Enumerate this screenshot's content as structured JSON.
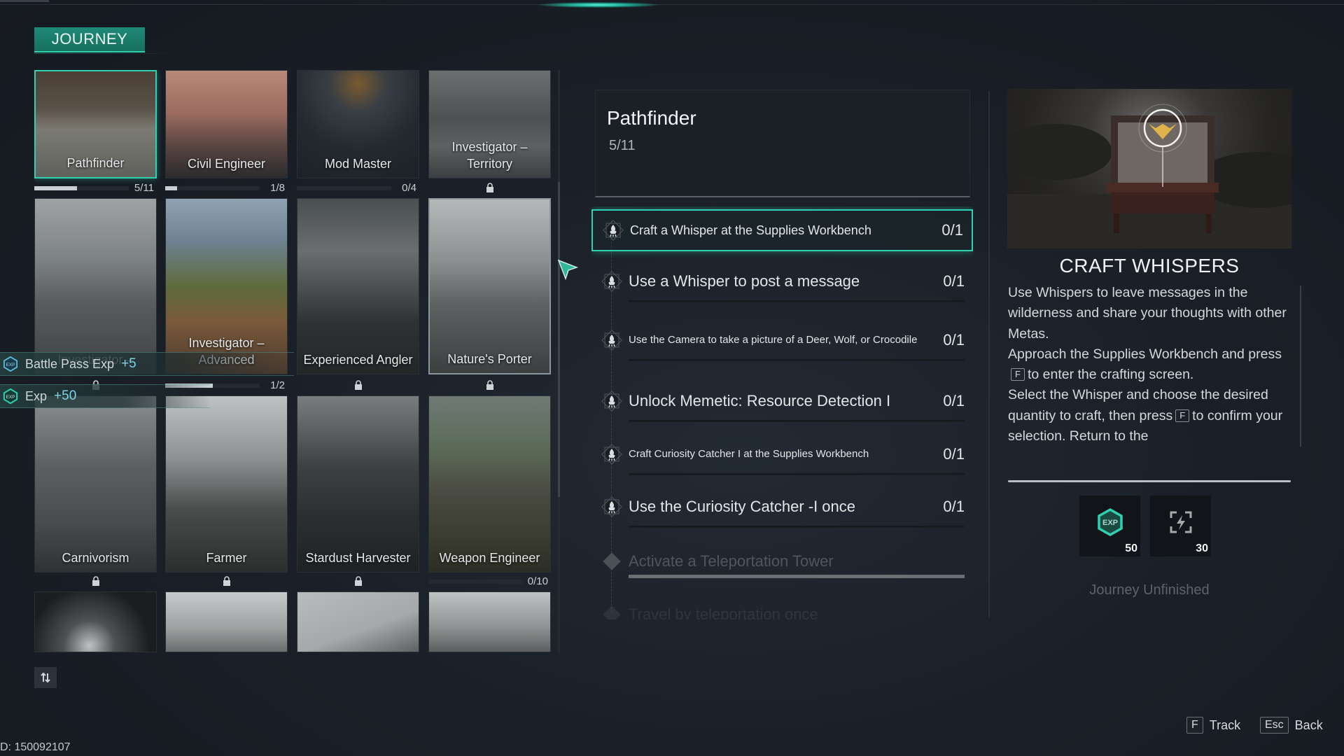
{
  "header": {
    "tab_label": "JOURNEY"
  },
  "cards": [
    {
      "name": "Pathfinder",
      "progress": "5/11",
      "fraction": 0.45,
      "locked": false,
      "selected": true
    },
    {
      "name": "Civil Engineer",
      "progress": "1/8",
      "fraction": 0.125,
      "locked": false
    },
    {
      "name": "Mod Master",
      "progress": "0/4",
      "fraction": 0,
      "locked": false
    },
    {
      "name": "Investigator – Territory",
      "progress": "",
      "locked": true
    },
    {
      "name": "Investigator –",
      "progress": "",
      "locked": true
    },
    {
      "name": "Investigator – Advanced",
      "progress": "1/2",
      "fraction": 0.5,
      "locked": false
    },
    {
      "name": "Experienced Angler",
      "progress": "",
      "locked": true
    },
    {
      "name": "Nature's Porter",
      "progress": "",
      "locked": true,
      "hover": true
    },
    {
      "name": "Carnivorism",
      "progress": "",
      "locked": true
    },
    {
      "name": "Farmer",
      "progress": "",
      "locked": true
    },
    {
      "name": "Stardust Harvester",
      "progress": "",
      "locked": true
    },
    {
      "name": "Weapon Engineer",
      "progress": "0/10",
      "fraction": 0,
      "locked": false
    },
    {
      "name": "",
      "progress": ""
    },
    {
      "name": "",
      "progress": ""
    },
    {
      "name": "",
      "progress": ""
    },
    {
      "name": "",
      "progress": ""
    }
  ],
  "toasts": [
    {
      "label": "Battle Pass Exp",
      "value": "+5",
      "icon": "battle-pass-exp-icon"
    },
    {
      "label": "Exp",
      "value": "+50",
      "icon": "exp-icon"
    }
  ],
  "quest": {
    "title": "Pathfinder",
    "progress": "5/11",
    "tasks": [
      {
        "text": "Craft a Whisper at the Supplies Workbench",
        "count": "0/1",
        "state": "selected"
      },
      {
        "text": "Use a Whisper to post a message",
        "count": "0/1",
        "state": "active"
      },
      {
        "text": "Use the Camera to take a picture of a Deer, Wolf, or Crocodile",
        "count": "0/1",
        "state": "active"
      },
      {
        "text": "Unlock Memetic: Resource Detection I",
        "count": "0/1",
        "state": "active"
      },
      {
        "text": "Craft Curiosity Catcher I at the Supplies Workbench",
        "count": "0/1",
        "state": "active"
      },
      {
        "text": "Use the Curiosity Catcher -I once",
        "count": "0/1",
        "state": "active"
      },
      {
        "text": "Activate a Teleportation Tower",
        "count": "",
        "state": "locked"
      },
      {
        "text": "Travel by teleportation once",
        "count": "",
        "state": "locked"
      }
    ]
  },
  "detail": {
    "title": "CRAFT WHISPERS",
    "desc_parts": {
      "p1": "Use Whispers to leave messages in the wilderness and share your thoughts with other Metas.",
      "p2a": "Approach the Supplies Workbench and press",
      "key1": "F",
      "p2b": "to enter the crafting screen.",
      "p3a": "Select the Whisper and choose the desired quantity to craft, then press",
      "key2": "F",
      "p3b": "to confirm your selection. Return to the"
    },
    "rewards": [
      {
        "icon": "exp-icon",
        "count": "50"
      },
      {
        "icon": "energy-icon",
        "count": "30"
      }
    ],
    "status": "Journey Unfinished"
  },
  "footer": {
    "track_key": "F",
    "track_label": "Track",
    "back_key": "Esc",
    "back_label": "Back",
    "player_id": "D: 150092107"
  },
  "colors": {
    "accent": "#2fd1b0",
    "tab_bg": "#1f8a78"
  }
}
